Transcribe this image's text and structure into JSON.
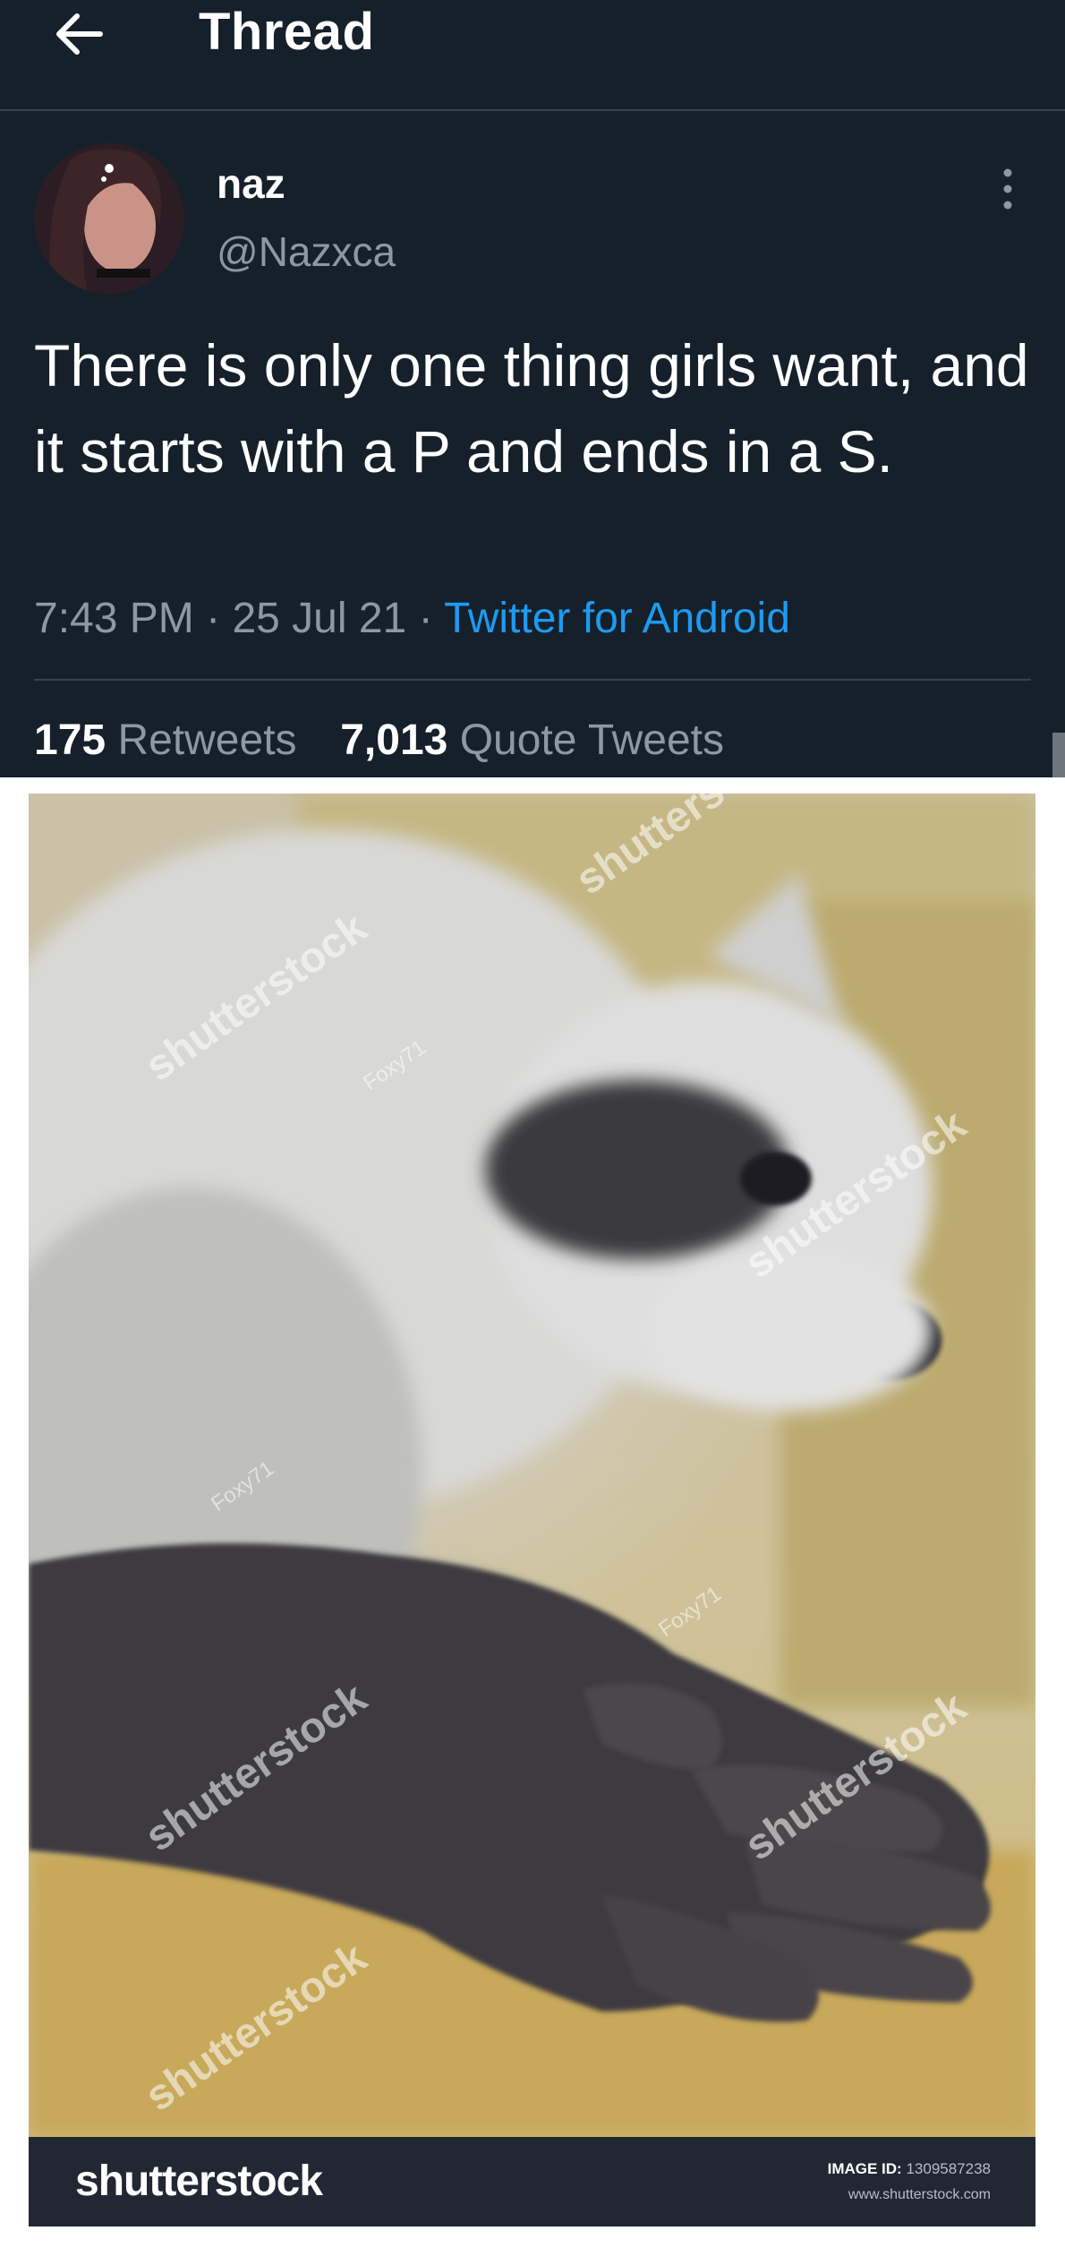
{
  "header": {
    "back_icon": "arrow-left-icon",
    "title": "Thread"
  },
  "tweet": {
    "author_name": "naz",
    "author_handle": "@Nazxca",
    "more_icon": "more-vertical-icon",
    "text": "There is only one thing girls want, and it starts with a P and ends in a S.",
    "time": "7:43 PM",
    "date": "25 Jul 21",
    "separator": "·",
    "source": "Twitter for Android",
    "retweets_count": "175",
    "retweets_label": "Retweets",
    "quotes_count": "7,013",
    "quotes_label": "Quote Tweets"
  },
  "image": {
    "watermarks": [
      "shutterstock",
      "shutterstock",
      "shutterstock",
      "shutterstock",
      "shutterstock",
      "shutters",
      "Foxy71",
      "Foxy71",
      "Foxy71"
    ],
    "brand": "shutterstock",
    "image_id_label": "IMAGE ID:",
    "image_id": "1309587238",
    "url": "www.shutterstock.com"
  },
  "colors": {
    "background": "#15202b",
    "accent": "#1d9bf0",
    "secondary_text": "#8b98a5",
    "divider": "#38444d"
  }
}
